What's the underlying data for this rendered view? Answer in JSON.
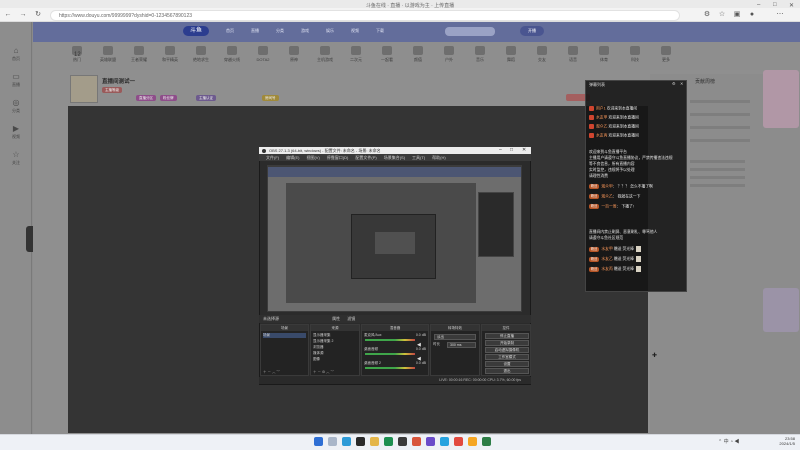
{
  "browser": {
    "window_title": "斗鱼在线 · 直播 · 以游戏为主 · 上传直播",
    "url": "https://www.douyu.com/9999999?dyshid=0-1234567890123",
    "colors": {
      "chrome": "#f3f3f3",
      "address_bar": "#ffffff"
    }
  },
  "rail": {
    "items": [
      {
        "icon": "home-icon",
        "label": "首页"
      },
      {
        "icon": "tv-icon",
        "label": "直播"
      },
      {
        "icon": "compass-icon",
        "label": "分类"
      },
      {
        "icon": "video-icon",
        "label": "视频"
      },
      {
        "icon": "star-icon",
        "label": "关注"
      }
    ]
  },
  "site": {
    "nav": [
      "首页",
      "直播",
      "分类",
      "游戏",
      "娱乐",
      "视频",
      "下载"
    ],
    "nav_button": "开播",
    "categories": [
      "热门",
      "英雄联盟",
      "王者荣耀",
      "和平精英",
      "绝地求生",
      "穿越火线",
      "DOTA2",
      "原神",
      "主机游戏",
      "二次元",
      "一起看",
      "颜值",
      "户外",
      "音乐",
      "舞蹈",
      "交友",
      "语音",
      "体育",
      "科技",
      "更多"
    ],
    "room": {
      "title": "直播间测试一",
      "level": "12",
      "tags": [
        "主播等级",
        "直播分区",
        "粉丝牌",
        "主播认证",
        "房间号"
      ]
    },
    "side_title": "贡献周榜",
    "accent": "#2c3d8f"
  },
  "obs": {
    "title": "OBS 27.1.3 (64-bit, windows) - 配置文件: 未命名 - 场景: 未命名",
    "menu": [
      "文件(F)",
      "编辑(E)",
      "视图(V)",
      "停靠窗口(D)",
      "配置文件(P)",
      "场景集合(S)",
      "工具(T)",
      "帮助(H)"
    ],
    "source_bar": {
      "no_source": "未选择源",
      "properties": "属性",
      "filters": "滤镜"
    },
    "docks": {
      "scenes": {
        "title": "场景",
        "items": [
          "场景"
        ]
      },
      "sources": {
        "title": "来源",
        "items": [
          "显示器采集",
          "显示器采集 2",
          "浏览器",
          "媒体源",
          "图像"
        ]
      },
      "mixer": {
        "title": "混音器",
        "channels": [
          {
            "name": "麦克风/Aux",
            "db": "0.0 dB"
          },
          {
            "name": "桌面音频",
            "db": "0.0 dB"
          },
          {
            "name": "桌面音频 2",
            "db": "0.0 dB"
          }
        ]
      },
      "transitions": {
        "title": "转场特效",
        "type": "淡出",
        "duration_label": "时长",
        "duration": "300 ms"
      },
      "controls": {
        "title": "控件",
        "buttons": [
          "停止直播",
          "开始录制",
          "启动虚拟摄像机",
          "工作室模式",
          "设置",
          "退出"
        ]
      }
    },
    "status": "LIVE: 00:00:16   REC: 00:00:00   CPU: 3.7%, 60.00 fps"
  },
  "chat": {
    "title": "弹幕列表",
    "lines": [
      {
        "user": "用户1",
        "text": "欢迎来到本直播间"
      },
      {
        "user": "水友甲",
        "text": "欢迎来到本直播间"
      },
      {
        "user": "观众乙",
        "text": "欢迎来到本直播间"
      },
      {
        "user": "水友丙",
        "text": "欢迎来到本直播间"
      }
    ],
    "notice": [
      "欢迎来到斗鱼直播平台",
      "主播用户请遵守斗鱼直播协议，严禁传播违法违规",
      "等不良信息，所有直播内容",
      "实时监控，违规将予以处理",
      "请理性消费"
    ],
    "messages": [
      {
        "user": "观众甲",
        "text": "？？？ 怎么不播了啊"
      },
      {
        "user": "观众乙",
        "text": "我就在这一下"
      },
      {
        "user": "一百一周",
        "text": "下播了!"
      }
    ],
    "notice2": [
      "直播间内禁止刷屏、恶意刷礼、辱骂他人",
      "请遵守斗鱼社区规范"
    ],
    "gifts": [
      {
        "user": "水友甲",
        "text": "赠送 荧光棒"
      },
      {
        "user": "水友乙",
        "text": "赠送 荧光棒"
      },
      {
        "user": "水友丙",
        "text": "赠送 荧光棒"
      }
    ]
  },
  "taskbar": {
    "time": "23:58",
    "date": "2024/1/5"
  }
}
